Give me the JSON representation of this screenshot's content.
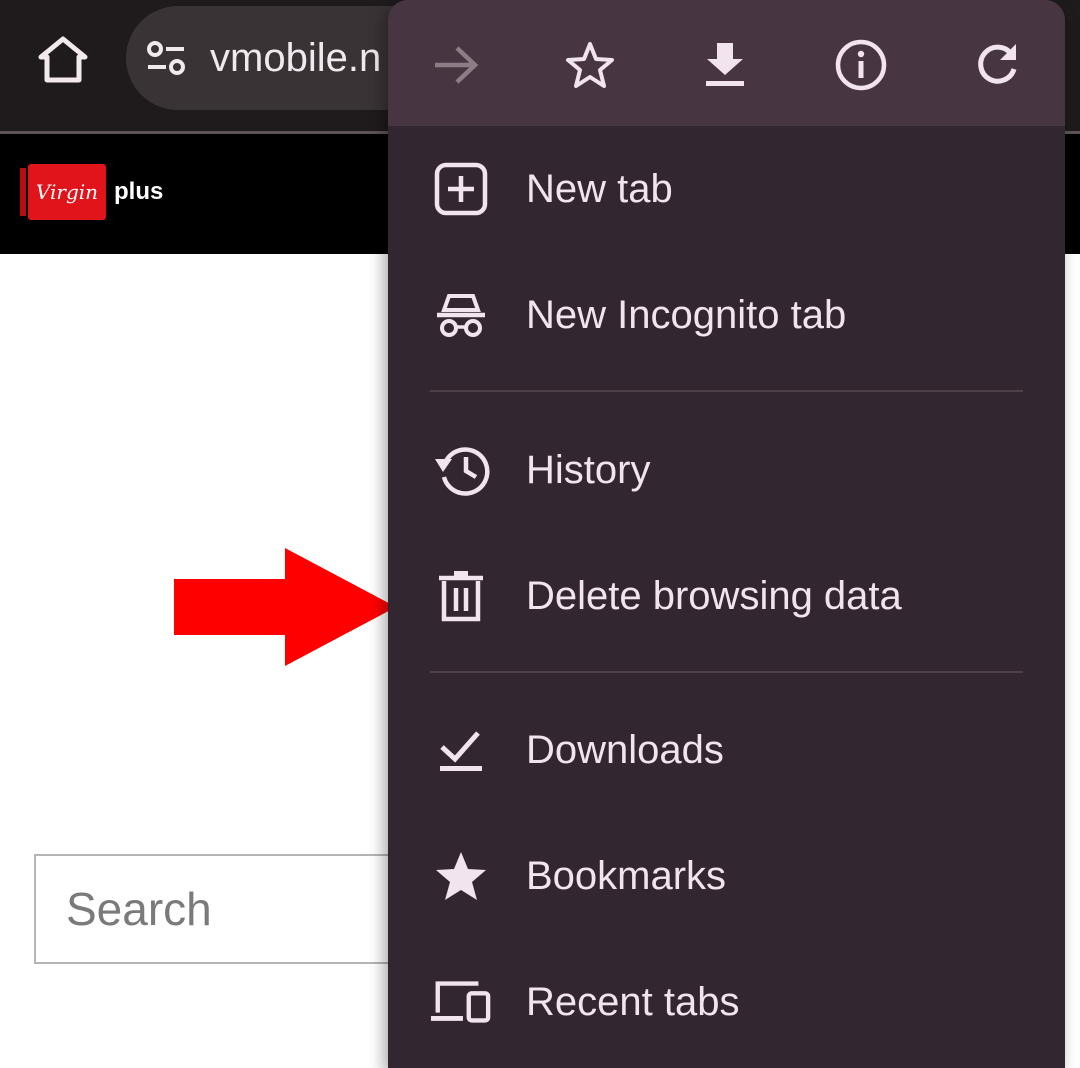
{
  "browser": {
    "url_text": "vmobile.n",
    "menu_icons": [
      "forward-icon",
      "star-outline-icon",
      "download-icon",
      "info-icon",
      "refresh-icon"
    ]
  },
  "site": {
    "logo_badge": "Virgin",
    "logo_suffix": "plus",
    "search_placeholder": "Search",
    "brand_color": "#e1141b"
  },
  "menu": {
    "items": [
      {
        "label": "New tab",
        "icon": "new-tab-icon"
      },
      {
        "label": "New Incognito tab",
        "icon": "incognito-icon"
      },
      {
        "label": "History",
        "icon": "history-icon"
      },
      {
        "label": "Delete browsing data",
        "icon": "trash-icon"
      },
      {
        "label": "Downloads",
        "icon": "downloads-check-icon"
      },
      {
        "label": "Bookmarks",
        "icon": "star-filled-icon"
      },
      {
        "label": "Recent tabs",
        "icon": "devices-icon"
      }
    ]
  },
  "colors": {
    "menu_bg": "#322630",
    "menu_header_bg": "#473641",
    "menu_text": "#f2e4ee",
    "annotation_arrow": "#ff0000"
  }
}
